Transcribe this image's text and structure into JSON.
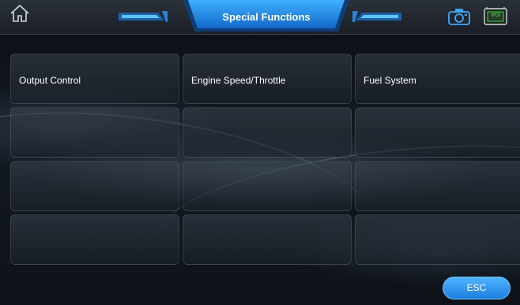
{
  "header": {
    "title": "Special Functions",
    "home_icon": "home-icon",
    "camera_icon": "camera-icon",
    "vci_icon": "vci-status-icon",
    "vci_label": "VCI"
  },
  "functions": [
    "Output Control",
    "Engine Speed/Throttle",
    "Fuel System",
    "",
    "",
    "",
    "",
    "",
    "",
    "",
    "",
    ""
  ],
  "footer": {
    "esc_label": "ESC"
  },
  "colors": {
    "accent": "#1e7fe0",
    "accent_light": "#4fb3ff",
    "vci_green": "#3bd14a"
  }
}
